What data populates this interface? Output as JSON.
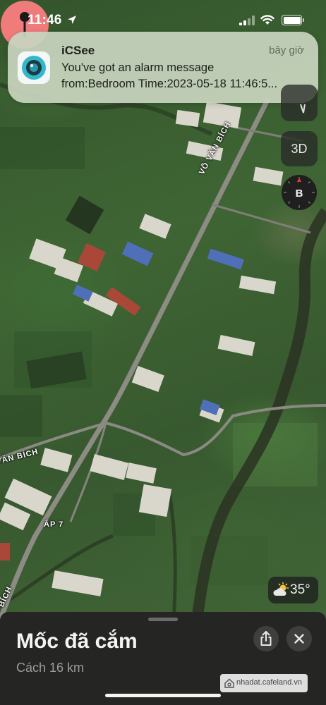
{
  "status_bar": {
    "time": "11:46",
    "icons": [
      "location-arrow-icon",
      "cellular-signal-icon",
      "wifi-icon",
      "battery-icon"
    ]
  },
  "notification": {
    "app_name": "iCSee",
    "when": "bây giờ",
    "line1": "You've got an alarm message",
    "line2": "from:Bedroom Time:2023-05-18 11:46:5...",
    "icon": "icsee-camera-icon"
  },
  "map": {
    "road_labels": [
      "VÕ VĂN BÍCH",
      "VĂN BÍCH",
      "ẤP 7",
      "BÍCH"
    ],
    "controls": {
      "three_d_label": "3D",
      "compass_label": "B"
    },
    "weather": {
      "temperature": "35°",
      "icon": "partly-cloudy-sun-icon"
    }
  },
  "sheet": {
    "title": "Mốc đã cắm",
    "subtitle": "Cách 16 km",
    "share_icon": "share-icon",
    "close_icon": "close-icon"
  },
  "watermark": {
    "text": "nhadat.cafeland.vn"
  },
  "colors": {
    "pin": "#ef7b7b",
    "sheet_bg": "#252624",
    "notification_bg": "#c8d4be"
  }
}
